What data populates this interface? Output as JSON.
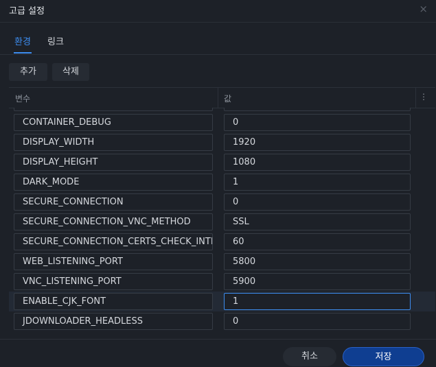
{
  "dialog": {
    "title": "고급 설정",
    "close_icon": "×"
  },
  "tabs": [
    {
      "label": "환경",
      "active": true
    },
    {
      "label": "링크",
      "active": false
    }
  ],
  "toolbar": {
    "add_label": "추가",
    "delete_label": "삭제"
  },
  "table": {
    "col_variable": "변수",
    "col_value": "값",
    "more_icon": "⋮",
    "rows": [
      {
        "name": "CONTAINER_DEBUG",
        "value": "0"
      },
      {
        "name": "DISPLAY_WIDTH",
        "value": "1920"
      },
      {
        "name": "DISPLAY_HEIGHT",
        "value": "1080"
      },
      {
        "name": "DARK_MODE",
        "value": "1"
      },
      {
        "name": "SECURE_CONNECTION",
        "value": "0"
      },
      {
        "name": "SECURE_CONNECTION_VNC_METHOD",
        "value": "SSL"
      },
      {
        "name": "SECURE_CONNECTION_CERTS_CHECK_INTERVAL",
        "value": "60"
      },
      {
        "name": "WEB_LISTENING_PORT",
        "value": "5800"
      },
      {
        "name": "VNC_LISTENING_PORT",
        "value": "5900"
      },
      {
        "name": "ENABLE_CJK_FONT",
        "value": "1"
      },
      {
        "name": "JDOWNLOADER_HEADLESS",
        "value": "0"
      }
    ]
  },
  "footer": {
    "cancel_label": "취소",
    "save_label": "저장"
  },
  "colors": {
    "accent": "#3d8df0",
    "primary_button": "#0f3e91",
    "background": "#1d2128"
  }
}
